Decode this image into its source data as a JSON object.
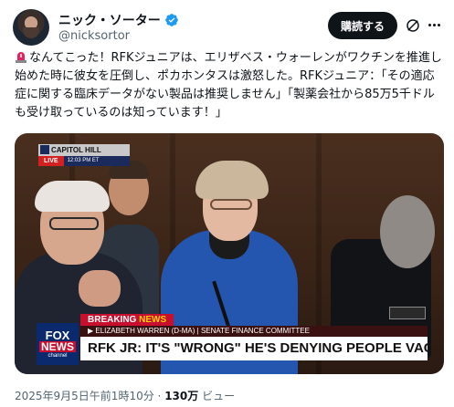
{
  "author": {
    "display_name": "ニック・ソーター",
    "handle": "@nicksortor",
    "verified": true
  },
  "actions": {
    "follow_label": "購読する",
    "grok_icon": "grok-icon",
    "more_icon": "more-icon"
  },
  "post": {
    "emoji": "siren-emoji",
    "text": "なんてこった！RFKジュニアは、エリザベス・ウォーレンがワクチンを推進し始めた時に彼女を圧倒し、ポカホンタスは激怒した。RFKジュニア：「その適応症に関する臨床データがない製品は推奨しません」「製薬会社から85万5千ドルも受け取っているのは知っています！」"
  },
  "media": {
    "location": "CAPITOL HILL",
    "live": "LIVE",
    "time": "12:03 PM ET",
    "breaking_prefix": "BREAKING",
    "breaking_suffix": "NEWS",
    "subline": "▶ ELIZABETH WARREN (D-MA) | SENATE FINANCE COMMITTEE",
    "headline": "RFK JR: IT'S \"WRONG\" HE'S DENYING PEOPLE VACCINES",
    "network_top": "FOX",
    "network_bottom": "NEWS",
    "network_sub": "channel"
  },
  "meta": {
    "timestamp": "2025年9月5日午前1時10分",
    "separator": "·",
    "views": "130万",
    "views_label": "ビュー"
  },
  "colors": {
    "verified": "#1d9bf0",
    "follow_bg": "#0f1419",
    "muted": "#536471",
    "fox_red": "#c8102e",
    "fox_blue": "#0b2a6e"
  }
}
